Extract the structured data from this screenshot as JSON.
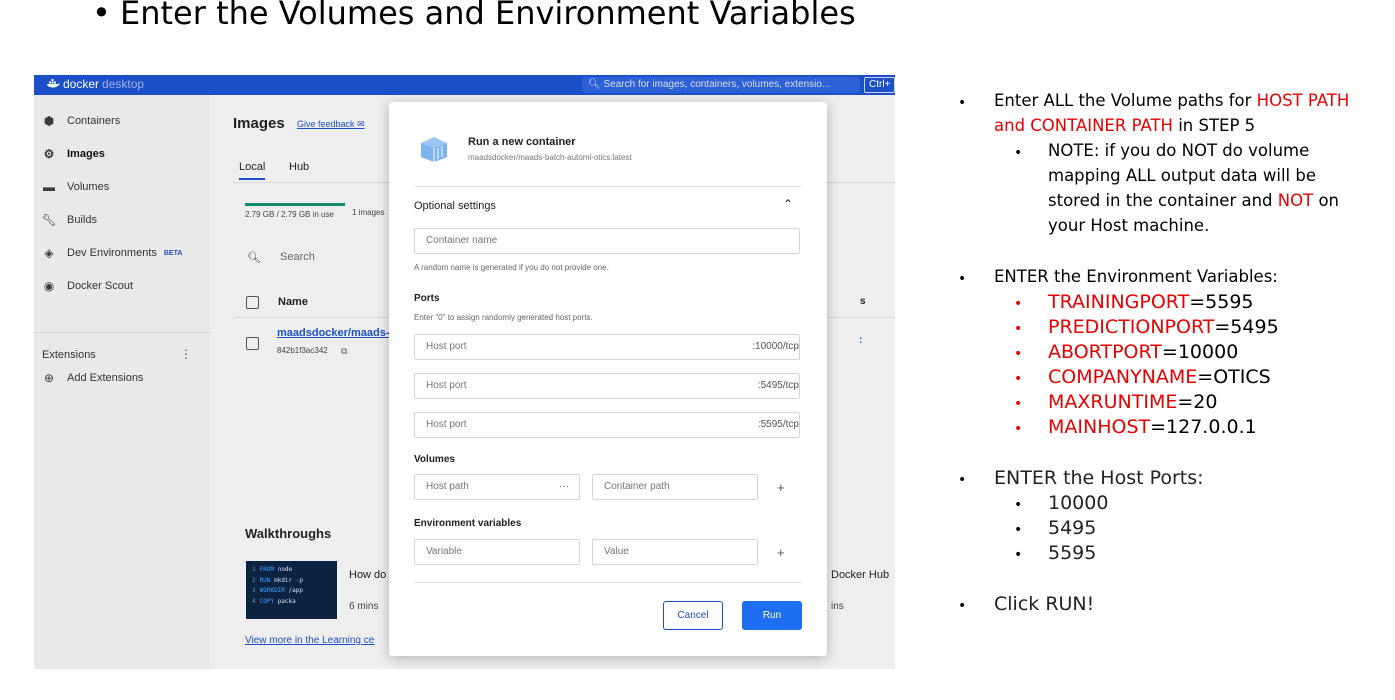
{
  "slide": {
    "title": "Enter the Volumes and Environment Variables"
  },
  "docker": {
    "brand": "docker",
    "brand_sub": "desktop",
    "search_placeholder": "Search for images, containers, volumes, extensio...",
    "search_shortcut": "Ctrl+",
    "sidebar": [
      {
        "label": "Containers",
        "icon": "container-icon"
      },
      {
        "label": "Images",
        "icon": "images-icon",
        "active": true
      },
      {
        "label": "Volumes",
        "icon": "volumes-icon"
      },
      {
        "label": "Builds",
        "icon": "wrench-icon"
      },
      {
        "label": "Dev Environments",
        "icon": "dev-env-icon",
        "badge": "BETA"
      },
      {
        "label": "Docker Scout",
        "icon": "scout-icon"
      }
    ],
    "extensions_label": "Extensions",
    "add_extensions_label": "Add Extensions",
    "main": {
      "title": "Images",
      "feedback": "Give feedback",
      "tabs": [
        "Local",
        "Hub"
      ],
      "usage": "2.79 GB / 2.79 GB in use",
      "image_count": "1 images",
      "search_placeholder": "Search",
      "col_name": "Name",
      "col_stub": "s",
      "image_name": "maadsdocker/maads-",
      "image_id": "842b1f3ac342",
      "walkthroughs_title": "Walkthroughs",
      "card_title": "How do",
      "card_time": "6 mins",
      "card2_title": "Docker Hub",
      "card2_time": "ins",
      "learn_link": "View more in the Learning ce",
      "code_lines": [
        {
          "n": "1",
          "kw": "FROM",
          "rest": "node"
        },
        {
          "n": "2",
          "kw": "RUN",
          "rest": "mkdir -p"
        },
        {
          "n": "3",
          "kw": "WORKDIR",
          "rest": "/app"
        },
        {
          "n": "4",
          "kw": "COPY",
          "rest": "packa"
        }
      ]
    },
    "modal": {
      "title": "Run a new container",
      "subtitle": "maadsdocker/maads-batch-automl-otics:latest",
      "optional_settings": "Optional settings",
      "container_name_placeholder": "Container name",
      "container_name_hint": "A random name is generated if you do not provide one.",
      "ports_label": "Ports",
      "ports_hint": "Enter \"0\" to assign randomly generated host ports.",
      "ports": [
        {
          "placeholder": "Host port",
          "suffix": ":10000/tcp"
        },
        {
          "placeholder": "Host port",
          "suffix": ":5495/tcp"
        },
        {
          "placeholder": "Host port",
          "suffix": ":5595/tcp"
        }
      ],
      "volumes_label": "Volumes",
      "host_path_placeholder": "Host path",
      "container_path_placeholder": "Container path",
      "env_label": "Environment variables",
      "variable_placeholder": "Variable",
      "value_placeholder": "Value",
      "cancel": "Cancel",
      "run": "Run"
    }
  },
  "notes": {
    "volume_line1_a": "Enter ALL the Volume paths for ",
    "volume_line1_b": "HOST PATH",
    "volume_line2_a": "and CONTAINER PATH",
    "volume_line2_b": " in STEP 5",
    "note_line1": "NOTE: if you do NOT do volume",
    "note_line2": "mapping ALL output data will be",
    "note_line3_a": "stored in the container and ",
    "note_line3_b": "NOT",
    "note_line3_c": " on",
    "note_line4": "your Host machine.",
    "env_heading": "ENTER the Environment Variables:",
    "env_vars": [
      {
        "key": "TRAININGPORT",
        "value": "=5595"
      },
      {
        "key": "PREDICTIONPORT",
        "value": "=5495"
      },
      {
        "key": "ABORTPORT",
        "value": "=10000"
      },
      {
        "key": "COMPANYNAME",
        "value": "=OTICS"
      },
      {
        "key": "MAXRUNTIME",
        "value": "=20"
      },
      {
        "key": "MAINHOST",
        "value": "=127.0.0.1"
      }
    ],
    "ports_heading": "ENTER the Host Ports:",
    "host_ports": [
      "10000",
      "5495",
      "5595"
    ],
    "click_run": "Click RUN!"
  }
}
